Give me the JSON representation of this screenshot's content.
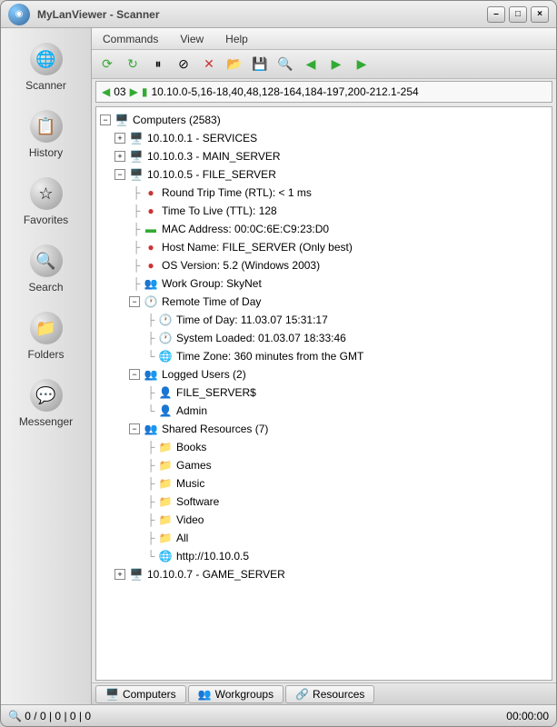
{
  "title": "MyLanViewer - Scanner",
  "menubar": [
    "Commands",
    "View",
    "Help"
  ],
  "sidebar": [
    {
      "label": "Scanner",
      "glyph": "🌐"
    },
    {
      "label": "History",
      "glyph": "📋"
    },
    {
      "label": "Favorites",
      "glyph": "☆"
    },
    {
      "label": "Search",
      "glyph": "🔍"
    },
    {
      "label": "Folders",
      "glyph": "📁"
    },
    {
      "label": "Messenger",
      "glyph": "💬"
    }
  ],
  "addressbar": {
    "prefix": "03",
    "range": "10.10.0-5,16-18,40,48,128-164,184-197,200-212.1-254"
  },
  "tree": {
    "root_label": "Computers (2583)",
    "host1": "10.10.0.1 - SERVICES",
    "host2": "10.10.0.3 - MAIN_SERVER",
    "host3": "10.10.0.5 - FILE_SERVER",
    "host3_details": {
      "rtl": "Round Trip Time (RTL): < 1 ms",
      "ttl": "Time To Live (TTL): 128",
      "mac": "MAC Address: 00:0C:6E:C9:23:D0",
      "hostname": "Host Name: FILE_SERVER (Only best)",
      "os": "OS Version: 5.2 (Windows 2003)",
      "workgroup": "Work Group: SkyNet",
      "remote_time": "Remote Time of Day",
      "tod": "Time of Day: 11.03.07 15:31:17",
      "loaded": "System Loaded: 01.03.07 18:33:46",
      "tz": "Time Zone: 360 minutes from the GMT",
      "logged": "Logged Users (2)",
      "user1": "FILE_SERVER$",
      "user2": "Admin",
      "shared": "Shared Resources (7)",
      "s1": "Books",
      "s2": "Games",
      "s3": "Music",
      "s4": "Software",
      "s5": "Video",
      "s6": "All",
      "s7": "http://10.10.0.5"
    },
    "host4": "10.10.0.7 - GAME_SERVER"
  },
  "tabs": [
    "Computers",
    "Workgroups",
    "Resources"
  ],
  "statusbar": {
    "left": "0 / 0  |  0  |  0  |  0",
    "right": "00:00:00"
  }
}
